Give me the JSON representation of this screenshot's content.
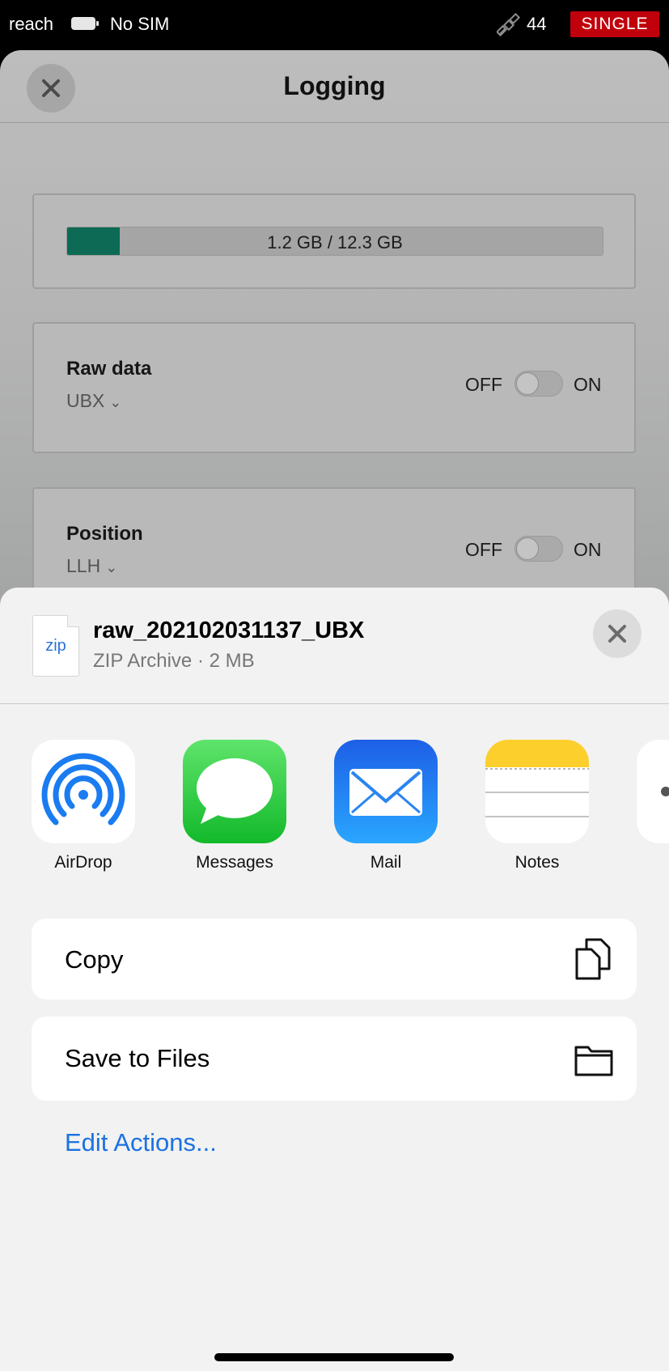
{
  "status_bar": {
    "carrier": "reach",
    "sim": "No SIM",
    "satellite_count": "44",
    "mode": "SINGLE",
    "mode_color": "#c0000a"
  },
  "app": {
    "title": "Logging",
    "storage": {
      "text": "1.2 GB / 12.3 GB",
      "used_fraction": 0.0976
    },
    "raw_data": {
      "label": "Raw data",
      "format": "UBX",
      "off_label": "OFF",
      "on_label": "ON",
      "enabled": false
    },
    "position": {
      "label": "Position",
      "format": "LLH",
      "off_label": "OFF",
      "on_label": "ON",
      "enabled": false
    }
  },
  "share_sheet": {
    "file": {
      "icon_text": "zip",
      "name": "raw_202102031137_UBX",
      "meta": "ZIP Archive · 2 MB"
    },
    "apps": [
      {
        "label": "AirDrop",
        "icon": "airdrop-icon"
      },
      {
        "label": "Messages",
        "icon": "messages-icon"
      },
      {
        "label": "Mail",
        "icon": "mail-icon"
      },
      {
        "label": "Notes",
        "icon": "notes-icon"
      }
    ],
    "actions": [
      {
        "label": "Copy",
        "icon": "copy-icon"
      },
      {
        "label": "Save to Files",
        "icon": "folder-icon"
      }
    ],
    "edit_actions": "Edit Actions...",
    "link_color": "#1b71e3"
  }
}
